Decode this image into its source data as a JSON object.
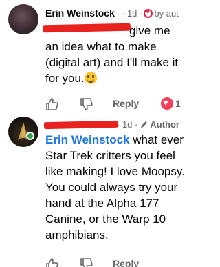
{
  "comments": [
    {
      "author": "Erin Weinstock",
      "time": "1d",
      "meta_suffix": "by aut",
      "text_line_1": "give me",
      "text_rest": "an idea what to make (digital art) and I'll make it for you.",
      "actions": {
        "reply": "Reply",
        "reaction_count": "1"
      }
    },
    {
      "time": "1d",
      "badge": "Author",
      "mention": "Erin Weinstock",
      "text": " what ever Star Trek critters you feel like making! I love Moopsy. You could always try your hand at the Alpha 177 Canine, or the Warp 10 amphibians.",
      "actions": {
        "reply": "Reply"
      }
    }
  ],
  "colors": {
    "link": "#1b74e4",
    "muted": "#65676b",
    "redaction": "#e8231f",
    "heart": "#f33e58",
    "online": "#31a24c"
  },
  "icons": [
    "thumbs-up-icon",
    "thumbs-down-icon",
    "heart-icon",
    "smiley-icon",
    "pen-icon"
  ]
}
